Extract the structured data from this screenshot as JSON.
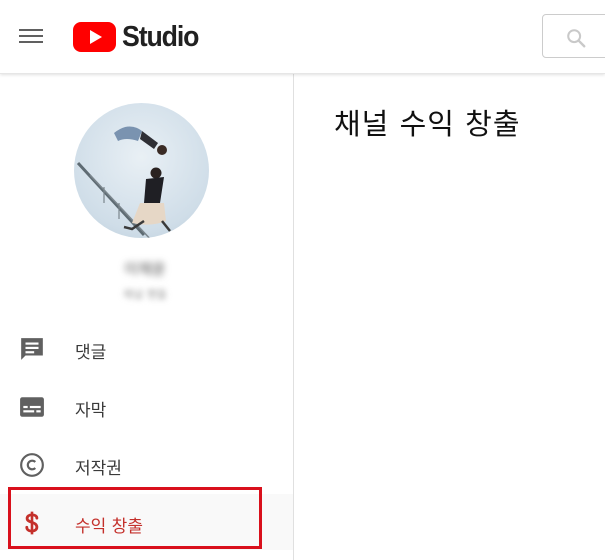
{
  "header": {
    "logo_text": "Studio",
    "colors": {
      "brand_red": "#ff0000"
    }
  },
  "channel": {
    "name": "이채윤",
    "handle": "채널 핸들"
  },
  "sidebar": {
    "items": [
      {
        "label": "댓글",
        "icon": "comment-icon"
      },
      {
        "label": "자막",
        "icon": "subtitles-icon"
      },
      {
        "label": "저작권",
        "icon": "copyright-icon"
      },
      {
        "label": "수익 창출",
        "icon": "dollar-icon",
        "active": true
      }
    ]
  },
  "main": {
    "title": "채널 수익 창출"
  }
}
